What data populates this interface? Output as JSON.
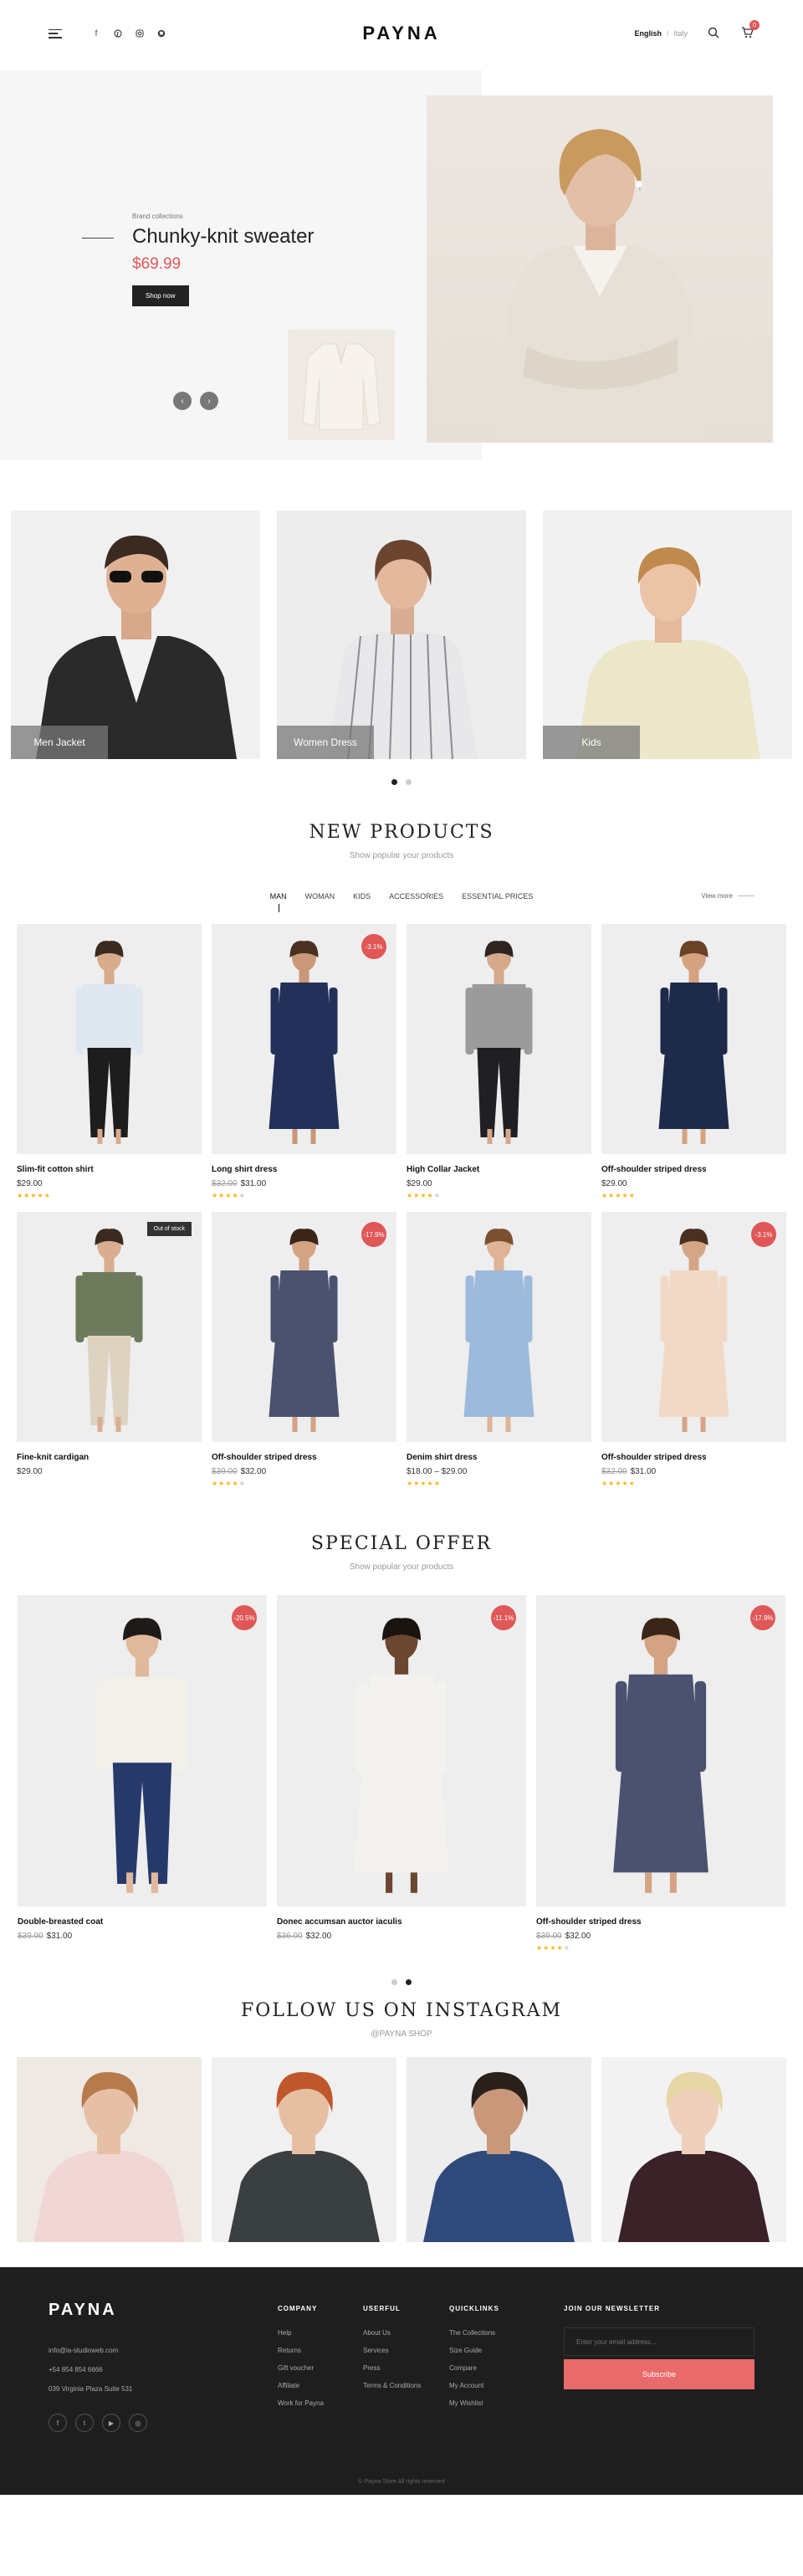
{
  "header": {
    "logo": "PAYNA",
    "socials": [
      "facebook-icon",
      "pinterest-icon",
      "instagram-icon",
      "github-icon"
    ],
    "language": "English",
    "separator": "/",
    "country": "Italy",
    "cart_count": "0"
  },
  "hero": {
    "eyebrow": "Brand collections",
    "title": "Chunky-knit sweater",
    "price": "$69.99",
    "cta": "Shop now",
    "prev": "‹",
    "next": "›"
  },
  "categories": [
    {
      "label": "Men Jacket"
    },
    {
      "label": "Women Dress"
    },
    {
      "label": "Kids"
    }
  ],
  "new_products": {
    "title": "NEW PRODUCTS",
    "subtitle": "Show popular your products",
    "tabs": [
      "MAN",
      "WOMAN",
      "KIDS",
      "ACCESSORIES",
      "ESSENTIAL PRICES"
    ],
    "view_more": "View more",
    "items": [
      {
        "name": "Slim-fit cotton shirt",
        "old": "",
        "price": "$29.00",
        "badge": "",
        "stars": 5
      },
      {
        "name": "Long shirt dress",
        "old": "$32.00",
        "price": "$31.00",
        "badge": "-3.1%",
        "stars": 4
      },
      {
        "name": "High Collar Jacket",
        "old": "",
        "price": "$29.00",
        "badge": "",
        "stars": 4
      },
      {
        "name": "Off-shoulder striped dress",
        "old": "",
        "price": "$29.00",
        "badge": "",
        "stars": 5
      },
      {
        "name": "Fine-knit cardigan",
        "old": "",
        "price": "$29.00",
        "badge": "Out of stock",
        "stars": 0
      },
      {
        "name": "Off-shoulder striped dress",
        "old": "$39.00",
        "price": "$32.00",
        "badge": "-17.9%",
        "stars": 4
      },
      {
        "name": "Denim shirt dress",
        "old": "",
        "price": "$18.00 – $29.00",
        "badge": "",
        "stars": 5
      },
      {
        "name": "Off-shoulder striped dress",
        "old": "$32.00",
        "price": "$31.00",
        "badge": "-3.1%",
        "stars": 5
      }
    ]
  },
  "special_offer": {
    "title": "SPECIAL OFFER",
    "subtitle": "Show popular your products",
    "items": [
      {
        "name": "Double-breasted coat",
        "old": "$39.00",
        "price": "$31.00",
        "badge": "-20.5%",
        "stars": 0
      },
      {
        "name": "Donec accumsan auctor iaculis",
        "old": "$36.00",
        "price": "$32.00",
        "badge": "-11.1%",
        "stars": 0
      },
      {
        "name": "Off-shoulder striped dress",
        "old": "$39.00",
        "price": "$32.00",
        "badge": "-17.9%",
        "stars": 4
      }
    ]
  },
  "instagram": {
    "title": "FOLLOW US ON INSTAGRAM",
    "handle": "@PAYNA SHOP"
  },
  "footer": {
    "logo": "PAYNA",
    "email": "info@la-studioweb.com",
    "phone": "+54 854 854 6666",
    "address": "039 Virginia Plaza Suite 531",
    "company": {
      "title": "COMPANY",
      "links": [
        "Help",
        "Returns",
        "Gift voucher",
        "Affiliate",
        "Work for Payna"
      ]
    },
    "userful": {
      "title": "USERFUL",
      "links": [
        "About Us",
        "Services",
        "Press",
        "Terms & Conditions"
      ]
    },
    "quicklinks": {
      "title": "QUICKLINKS",
      "links": [
        "The Collections",
        "Size Guide",
        "Compare",
        "My Account",
        "My Wishlist"
      ]
    },
    "newsletter": {
      "title": "JOIN OUR NEWSLETTER",
      "placeholder": "Enter your email address...",
      "button": "Subscribe"
    },
    "copyright": "© Payna Store All rights reserved"
  },
  "colors": {
    "accent": "#e05757",
    "footer_bg": "#1e1e1e",
    "stars": "#f2b51c"
  }
}
